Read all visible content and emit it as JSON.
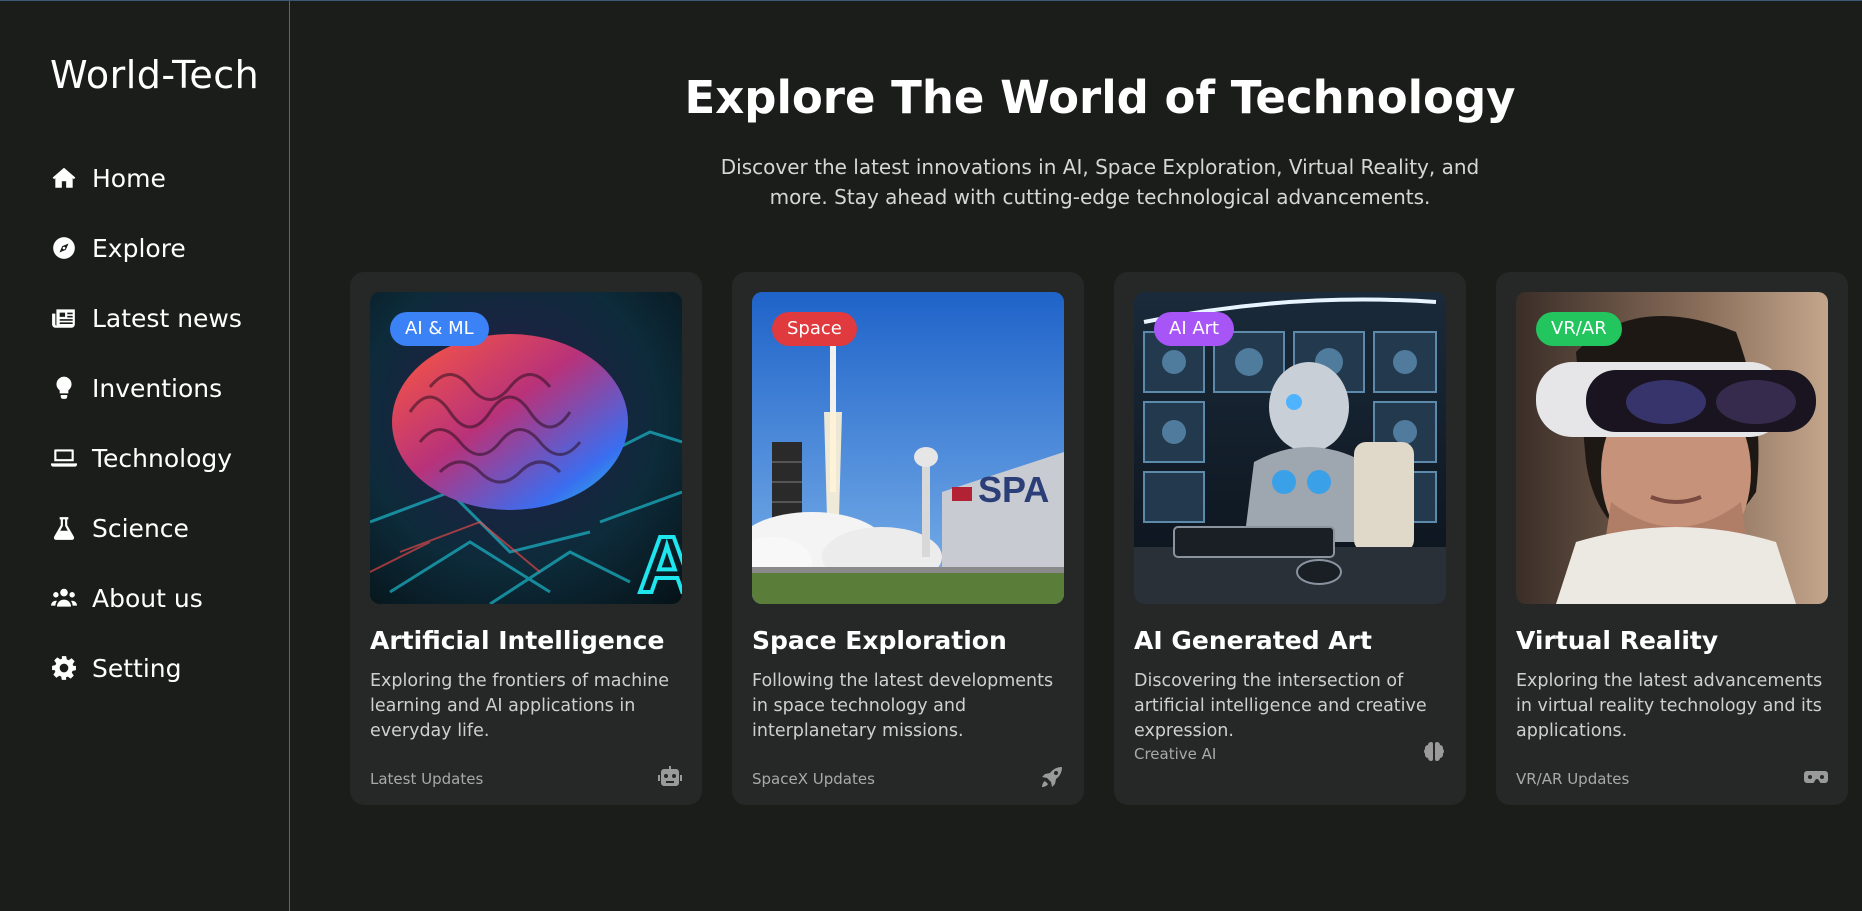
{
  "brand": "World-Tech",
  "nav": [
    {
      "label": "Home",
      "icon": "home-icon"
    },
    {
      "label": "Explore",
      "icon": "compass-icon"
    },
    {
      "label": "Latest news",
      "icon": "newspaper-icon"
    },
    {
      "label": "Inventions",
      "icon": "lightbulb-icon"
    },
    {
      "label": "Technology",
      "icon": "laptop-icon"
    },
    {
      "label": "Science",
      "icon": "flask-icon"
    },
    {
      "label": "About us",
      "icon": "users-icon"
    },
    {
      "label": "Setting",
      "icon": "gear-icon"
    }
  ],
  "hero": {
    "title": "Explore The World of Technology",
    "subtitle": "Discover the latest innovations in AI, Space Exploration, Virtual Reality, and more. Stay ahead with cutting-edge technological advancements."
  },
  "cards": [
    {
      "badge": "AI & ML",
      "badge_color": "#3b82f6",
      "title": "Artificial Intelligence",
      "description": "Exploring the frontiers of machine learning and AI applications in everyday life.",
      "footer": "Latest Updates",
      "footer_icon": "robot-icon"
    },
    {
      "badge": "Space",
      "badge_color": "#e0393e",
      "title": "Space Exploration",
      "description": "Following the latest developments in space technology and interplanetary missions.",
      "footer": "SpaceX Updates",
      "footer_icon": "rocket-icon"
    },
    {
      "badge": "AI Art",
      "badge_color": "#a855f7",
      "title": "AI Generated Art",
      "description": "Discovering the intersection of artificial intelligence and creative expression.",
      "footer": "Creative AI",
      "footer_icon": "brain-icon"
    },
    {
      "badge": "VR/AR",
      "badge_color": "#22c55e",
      "title": "Virtual Reality",
      "description": "Exploring the latest advancements in virtual reality technology and its applications.",
      "footer": "VR/AR Updates",
      "footer_icon": "vr-headset-icon"
    }
  ],
  "colors": {
    "background": "#1b1d1b",
    "card": "#252826",
    "sidebar_border": "#4a6a8a"
  }
}
